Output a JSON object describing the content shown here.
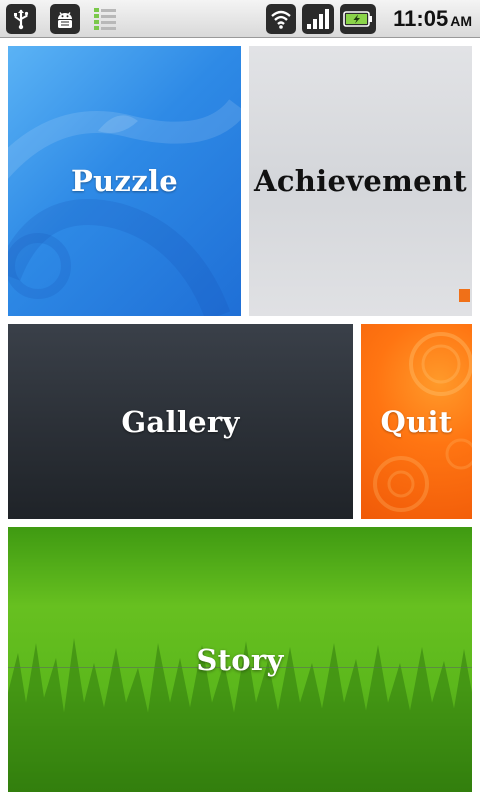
{
  "status_bar": {
    "icons": [
      "usb-icon",
      "android-debug-icon",
      "signal-bars-icon",
      "wifi-icon",
      "cell-signal-icon",
      "battery-charging-icon"
    ],
    "time": "11:05",
    "ampm": "AM"
  },
  "menu": {
    "puzzle": "Puzzle",
    "achievement": "Achievement",
    "gallery": "Gallery",
    "quit": "Quit",
    "story": "Story"
  },
  "colors": {
    "puzzle": "#2e8ae6",
    "achievement": "#d8d9dc",
    "gallery": "#2c3138",
    "quit": "#ff7512",
    "story": "#5cb81c"
  }
}
